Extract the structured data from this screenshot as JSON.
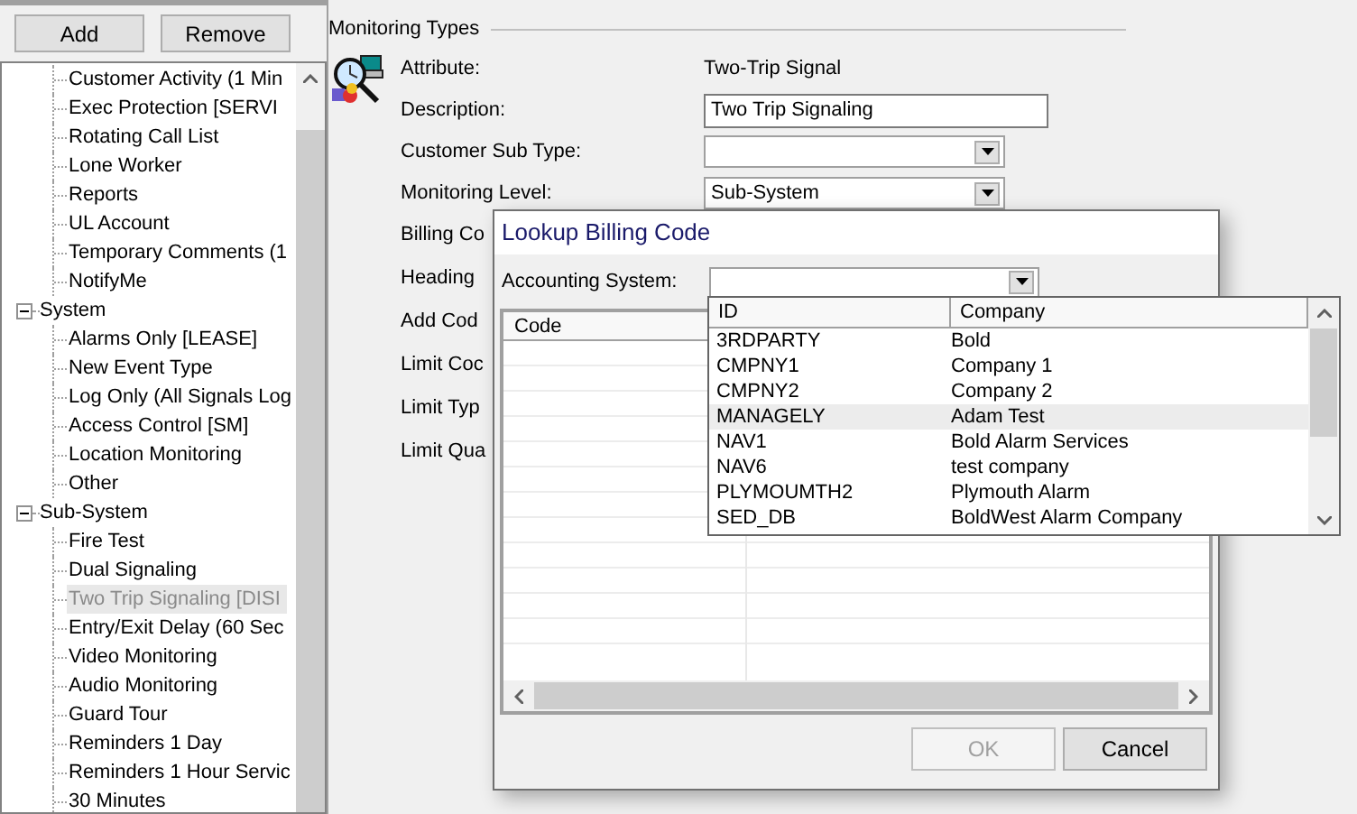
{
  "toolbar": {
    "buttons": [
      {
        "label": "Add"
      },
      {
        "label": "Remove"
      }
    ]
  },
  "tree": [
    {
      "children": [
        {
          "label": "Customer Activity (1 Min",
          "selected": false
        },
        {
          "label": "Exec Protection [SERVI",
          "selected": false
        },
        {
          "label": "Rotating Call List",
          "selected": false
        },
        {
          "label": "Lone Worker",
          "selected": false
        },
        {
          "label": "Reports",
          "selected": false
        },
        {
          "label": "UL Account",
          "selected": false
        },
        {
          "label": "Temporary Comments (1",
          "selected": false
        },
        {
          "label": "NotifyMe",
          "selected": false
        }
      ]
    },
    {
      "label": "System",
      "expanded": true,
      "children": [
        {
          "label": "Alarms Only [LEASE]",
          "selected": false
        },
        {
          "label": "New Event Type",
          "selected": false
        },
        {
          "label": "Log Only (All Signals Log",
          "selected": false
        },
        {
          "label": "Access Control [SM]",
          "selected": false
        },
        {
          "label": "Location Monitoring",
          "selected": false
        },
        {
          "label": "Other",
          "selected": false
        }
      ]
    },
    {
      "label": "Sub-System",
      "expanded": true,
      "children": [
        {
          "label": "Fire Test",
          "selected": false
        },
        {
          "label": "Dual Signaling",
          "selected": false
        },
        {
          "label": "Two Trip Signaling [DISI",
          "selected": true
        },
        {
          "label": "Entry/Exit Delay (60 Sec",
          "selected": false
        },
        {
          "label": "Video Monitoring",
          "selected": false
        },
        {
          "label": "Audio Monitoring",
          "selected": false
        },
        {
          "label": "Guard Tour",
          "selected": false
        },
        {
          "label": "Reminders 1 Day",
          "selected": false
        },
        {
          "label": "Reminders 1 Hour Servic",
          "selected": false
        },
        {
          "label": "30 Minutes",
          "selected": false
        }
      ]
    }
  ],
  "group": {
    "title": "Monitoring Types"
  },
  "fields": [
    {
      "label": "Attribute:",
      "kind": "text",
      "value": "Two-Trip Signal"
    },
    {
      "label": "Description:",
      "kind": "input",
      "value": "Two Trip Signaling"
    },
    {
      "label": "Customer Sub Type:",
      "kind": "combo"
    },
    {
      "label": "Monitoring Level:",
      "kind": "combo",
      "value": "Sub-System"
    },
    {
      "label": "Billing Co",
      "kind": "label"
    },
    {
      "label": "Heading",
      "kind": "label"
    },
    {
      "label": "Add Cod",
      "kind": "label"
    },
    {
      "label": "Limit Coc",
      "kind": "label"
    },
    {
      "label": "Limit Typ",
      "kind": "label"
    },
    {
      "label": "Limit Qua",
      "kind": "label"
    }
  ],
  "dialog": {
    "title": "Lookup Billing Code",
    "accounting_label": "Accounting System:",
    "grid": {
      "columns": [
        "Code"
      ]
    },
    "buttons": [
      {
        "label": "OK",
        "disabled": true
      },
      {
        "label": "Cancel",
        "disabled": false
      }
    ]
  },
  "dropdown": {
    "columns": [
      "ID",
      "Company"
    ],
    "rows": [
      {
        "id": "3RDPARTY",
        "company": "Bold",
        "selected": false
      },
      {
        "id": "CMPNY1",
        "company": "Company 1",
        "selected": false
      },
      {
        "id": "CMPNY2",
        "company": "Company 2",
        "selected": false
      },
      {
        "id": "MANAGELY",
        "company": "Adam Test",
        "selected": true
      },
      {
        "id": "NAV1",
        "company": "Bold Alarm Services",
        "selected": false
      },
      {
        "id": "NAV6",
        "company": "test company",
        "selected": false
      },
      {
        "id": "PLYMOUMTH2",
        "company": "Plymouth Alarm",
        "selected": false
      },
      {
        "id": "SED_DB",
        "company": "BoldWest Alarm Company",
        "selected": false
      }
    ]
  }
}
